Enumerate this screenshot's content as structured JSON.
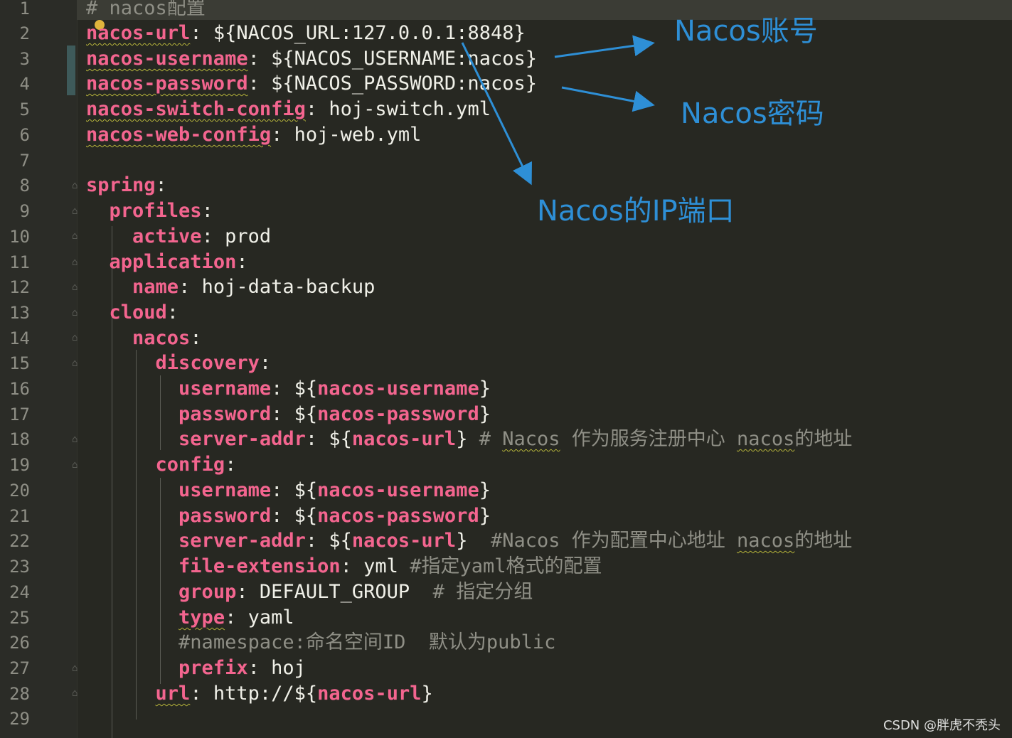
{
  "editor": {
    "line_numbers": [
      "1",
      "2",
      "3",
      "4",
      "5",
      "6",
      "7",
      "8",
      "9",
      "10",
      "11",
      "12",
      "13",
      "14",
      "15",
      "16",
      "17",
      "18",
      "19",
      "20",
      "21",
      "22",
      "23",
      "24",
      "25",
      "26",
      "27",
      "28",
      "29"
    ],
    "lines": {
      "l1_comment": "# nacos配置",
      "l2_key": "nacos-url",
      "l2_val": "${NACOS_URL:127.0.0.1:8848}",
      "l3_key": "nacos-username",
      "l3_val": "${NACOS_USERNAME:nacos}",
      "l4_key": "nacos-password",
      "l4_val": "${NACOS_PASSWORD:nacos}",
      "l5_key": "nacos-switch-config",
      "l5_val": "hoj-switch.yml",
      "l6_key": "nacos-web-config",
      "l6_val": "hoj-web.yml",
      "l8_key": "spring",
      "l9_key": "profiles",
      "l10_key": "active",
      "l10_val": "prod",
      "l11_key": "application",
      "l12_key": "name",
      "l12_val": "hoj-data-backup",
      "l13_key": "cloud",
      "l14_key": "nacos",
      "l15_key": "discovery",
      "l16_key": "username",
      "l16_pre": "${",
      "l16_ref": "nacos-username",
      "l16_post": "}",
      "l17_key": "password",
      "l17_pre": "${",
      "l17_ref": "nacos-password",
      "l17_post": "}",
      "l18_key": "server-addr",
      "l18_pre": "${",
      "l18_ref": "nacos-url",
      "l18_post": "}",
      "l18_c1": "# ",
      "l18_c2": "Nacos",
      "l18_c3": " 作为服务注册中心 ",
      "l18_c4": "nacos",
      "l18_c5": "的地址",
      "l19_key": "config",
      "l20_key": "username",
      "l20_pre": "${",
      "l20_ref": "nacos-username",
      "l20_post": "}",
      "l21_key": "password",
      "l21_pre": "${",
      "l21_ref": "nacos-password",
      "l21_post": "}",
      "l22_key": "server-addr",
      "l22_pre": "${",
      "l22_ref": "nacos-url",
      "l22_post": "}",
      "l22_c1": "  #Nacos 作为配置中心地址 ",
      "l22_c2": "nacos",
      "l22_c3": "的地址",
      "l23_key": "file-extension",
      "l23_val": "yml",
      "l23_c": "#指定yaml格式的配置",
      "l24_key": "group",
      "l24_val": "DEFAULT_GROUP",
      "l24_c": "  # 指定分组",
      "l25_key": "type",
      "l25_val": "yaml",
      "l26_c": "#namespace:命名空间ID  默认为public",
      "l27_key": "prefix",
      "l27_val": "hoj",
      "l28_key": "url",
      "l28_pre": "http://${",
      "l28_ref": "nacos-url",
      "l28_post": "}"
    }
  },
  "annotations": {
    "account": "Nacos账号",
    "password": "Nacos密码",
    "ip_port": "Nacos的IP端口"
  },
  "watermark": "CSDN @胖虎不秃头",
  "colors": {
    "background": "#272822",
    "key": "#f3658f",
    "comment": "#8f8f86",
    "annotation": "#2e8fd6"
  }
}
